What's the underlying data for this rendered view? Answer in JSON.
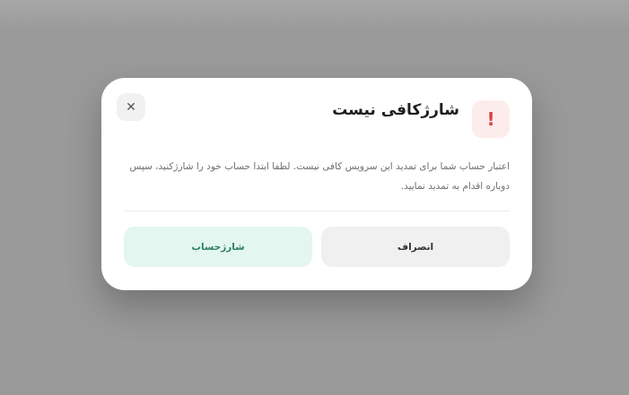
{
  "dialog": {
    "title": "شارژکافی نیست",
    "alert_symbol": "!",
    "close_symbol": "✕",
    "message": "اعتبار حساب شما برای تمدید این سرویس کافی نیست. لطفا ابتدا حساب خود را شارژکنید، سپس دوباره اقدام به تمدید نمایید.",
    "cancel_label": "انصراف",
    "charge_label": "شارژحساب"
  },
  "colors": {
    "alert_bg": "#fdecec",
    "alert_fg": "#d64545",
    "charge_bg": "#e3f6ef",
    "charge_fg": "#2f7f62",
    "cancel_bg": "#f0f0f0"
  },
  "icons": {
    "alert": "exclamation-icon",
    "close": "close-icon"
  }
}
